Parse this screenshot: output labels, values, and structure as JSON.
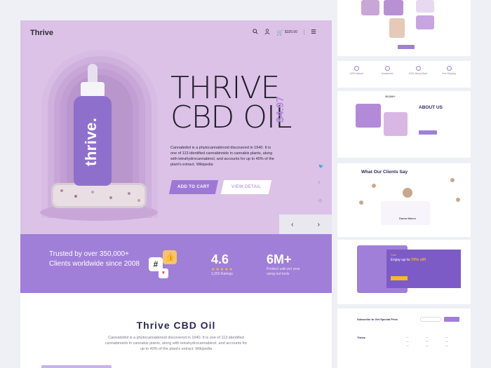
{
  "header": {
    "brand": "Thrive",
    "cart_value": "$325.00",
    "icons": [
      "search-icon",
      "user-icon",
      "cart-icon",
      "menu-icon"
    ]
  },
  "hero": {
    "product_label": "thrive.",
    "title_line1": "THRIVE",
    "title_line2": "CBD OIL",
    "price": "$4.97",
    "description": "Cannabidiol is a phytocannabinoid discovered in 1940. It is one of 113 identified cannabinoids in cannabis plants, along with tetrahydrocannabinol, and accounts for up to 40% of the plant's extract. Wikipedia",
    "add_to_cart": "ADD TO CART",
    "view_detail": "VIEW DETAIL",
    "social_icons": [
      "twitter-icon",
      "facebook-icon",
      "instagram-icon"
    ],
    "prev": "‹",
    "next": "›"
  },
  "stats": {
    "trust_text": "Trusted by over 350,000+ Clients worldwide since 2008",
    "badge_hash": "#",
    "badge_like": "👍",
    "badge_heart": "♥",
    "rating_value": "4.6",
    "rating_stars": "★★★★★",
    "rating_label": "3,350 Ratings",
    "sales_value": "6M+",
    "sales_label": "Product sale per year using out tools"
  },
  "product_info": {
    "name": "Thrive CBD Oil",
    "description": "Cannabidiol is a phytocannabinoid discovered in 1940. It is one of 113 identified cannabinoids in cannabis plants, along with tetrahydrocannabinol, and accounts for up to 40% of the plant's extract. Wikipedia"
  },
  "side": {
    "about_title": "ABOUT US",
    "about_badge": "35,000+",
    "clients_title": "What Our Clients Say",
    "sale_tag": "Sale",
    "sale_text": "Enjoy up to",
    "sale_percent": "70% off!",
    "subscribe_title": "Subscribe to Get Special Price",
    "footer_brand": "Thrive",
    "testimonial_name": "Dania Waren"
  },
  "colors": {
    "hero_bg": "#dcc2e7",
    "accent": "#a07fd8",
    "bottle": "#8f6fcc",
    "star": "#f6c344",
    "sale_orange": "#f7b733"
  }
}
